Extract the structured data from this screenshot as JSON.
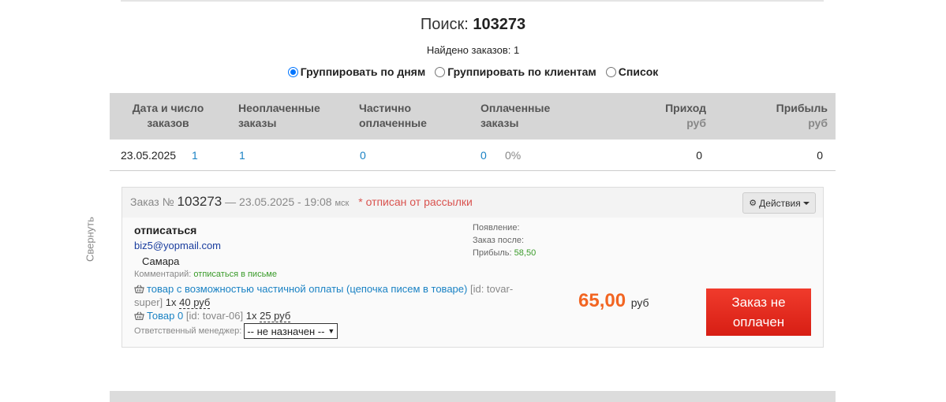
{
  "search": {
    "label": "Поиск:",
    "query": "103273"
  },
  "found": "Найдено заказов: 1",
  "grouping": [
    {
      "label": "Группировать по дням",
      "checked": true
    },
    {
      "label": "Группировать по клиентам",
      "checked": false
    },
    {
      "label": "Список",
      "checked": false
    }
  ],
  "summary": {
    "headers": {
      "date": [
        "Дата и число",
        "заказов"
      ],
      "unpaid": [
        "Неоплаченные",
        "заказы"
      ],
      "partial": [
        "Частично",
        "оплаченные"
      ],
      "paid": [
        "Оплаченные",
        "заказы"
      ],
      "income": [
        "Приход",
        "руб"
      ],
      "profit": [
        "Прибыль",
        "руб"
      ]
    },
    "row": {
      "date": "23.05.2025",
      "count": "1",
      "unpaid": "1",
      "partial": "0",
      "paid": "0",
      "paid_pct": "0%",
      "income": "0",
      "profit": "0"
    }
  },
  "collapse_label": "Свернуть",
  "order": {
    "prefix": "Заказ №",
    "number": "103273",
    "datetime": "— 23.05.2025 - 19:08",
    "tz": "мск",
    "flag": "* отписан от рассылки",
    "actions_label": "Действия",
    "client_name": "отписаться",
    "email": "biz5@yopmail.com",
    "city": "Самара",
    "comment_label": "Комментарий:",
    "comment_value": "отписаться в письме",
    "products": [
      {
        "name": "товар с возможностью частичной оплаты (цепочка писем в товаре)",
        "id_line1": "[id: tovar-",
        "id_line2": "super]",
        "qty": "1x",
        "price": "40 руб"
      },
      {
        "name": "Товар 0",
        "id": "[id: tovar-06]",
        "qty": "1x",
        "price": "25 руб"
      }
    ],
    "manager_label": "Ответственный менеджер:",
    "manager_value": "-- не назначен --",
    "meta": {
      "appear_label": "Появление:",
      "after_label": "Заказ после:",
      "profit_label": "Прибыль:",
      "profit_value": "58,50"
    },
    "total": "65,00",
    "total_currency": "руб",
    "status": [
      "Заказ не",
      "оплачен"
    ]
  }
}
